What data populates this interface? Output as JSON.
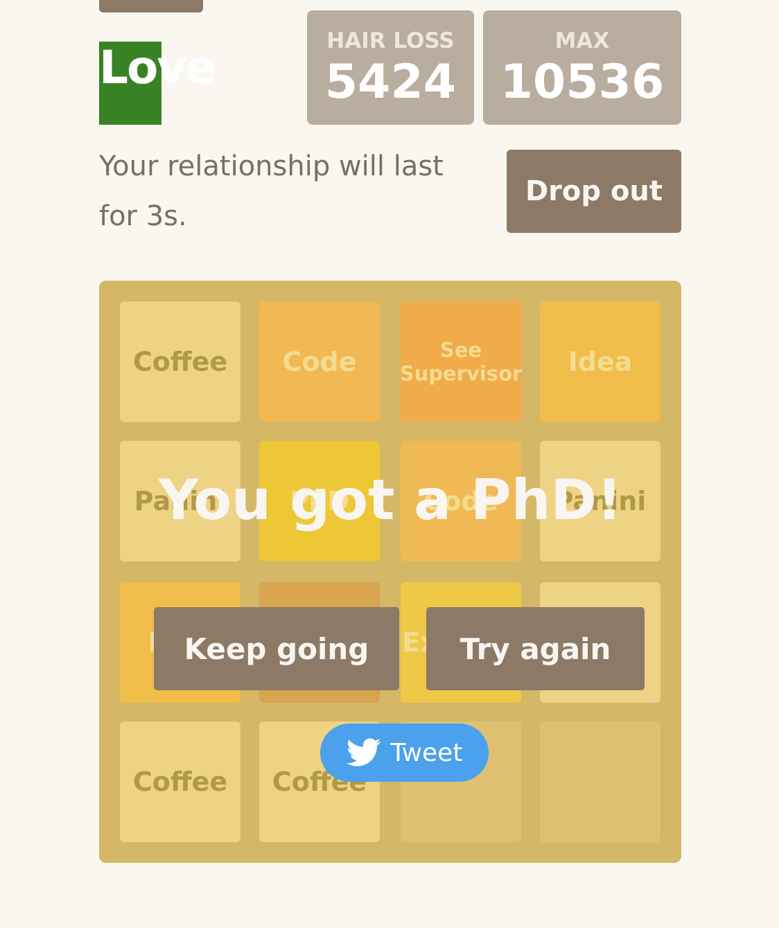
{
  "header": {
    "logo_text": "Love",
    "scores": [
      {
        "label": "HAIR LOSS",
        "value": "5424"
      },
      {
        "label": "MAX",
        "value": "10536"
      }
    ]
  },
  "intro": {
    "text": "Your relationship will last for 3s.",
    "drop_out_label": "Drop out"
  },
  "board": {
    "rows": [
      [
        "Coffee",
        "Code",
        "See Supervisor",
        "Idea"
      ],
      [
        "Panini",
        "PhD",
        "Code",
        "Panini"
      ],
      [
        "Idea",
        "",
        "Ex",
        ""
      ],
      [
        "Coffee",
        "Coffee",
        "",
        ""
      ]
    ]
  },
  "overlay": {
    "message": "You got a PhD!",
    "keep_going_label": "Keep going",
    "try_again_label": "Try again",
    "tweet_label": "Tweet"
  },
  "colors": {
    "background": "#f9f7ef",
    "button": "#8c7a66",
    "score_box": "#b8ad9e",
    "logo": "#3a8226",
    "tweet": "#4ba1ec"
  }
}
